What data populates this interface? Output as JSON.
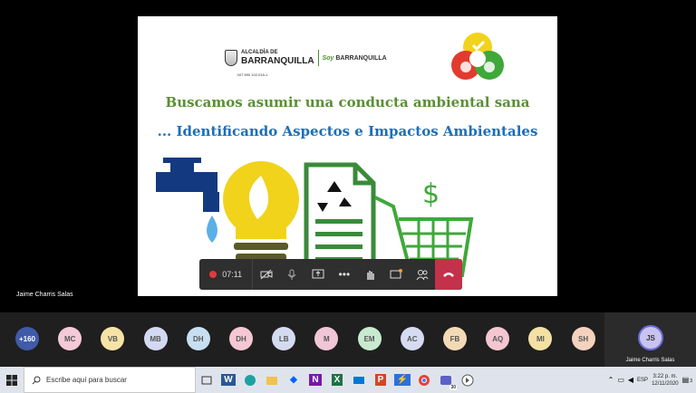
{
  "slide": {
    "org_prefix": "ALCALDÍA DE",
    "org_name": "BARRANQUILLA",
    "soy": "Soy",
    "soy_city": "BARRANQUILLA",
    "nit": "NIT 890 102.018-1",
    "title_line1": "Buscamos asumir una conducta ambiental sana",
    "title_line2": "... Identificando Aspectos e Impactos Ambientales",
    "colors": {
      "green": "#5a8f32",
      "blue": "#1d6fb8",
      "navy": "#133a80",
      "yellow": "#f1d31c"
    }
  },
  "call_controls": {
    "timer": "07:11",
    "buttons": [
      "camera-off",
      "mic",
      "share-screen",
      "more",
      "raise-hand",
      "chat",
      "participants",
      "hang-up"
    ]
  },
  "presenter_name": "Jaime Charris Salas",
  "participants": [
    {
      "initials": "+160",
      "color": "#3f5ba9",
      "text_color": "#ffffff"
    },
    {
      "initials": "MC",
      "color": "#f4c9d8"
    },
    {
      "initials": "VB",
      "color": "#f7e3a6"
    },
    {
      "initials": "MB",
      "color": "#d3d9f2"
    },
    {
      "initials": "DH",
      "color": "#c8dff2"
    },
    {
      "initials": "DH",
      "color": "#f5c7d4"
    },
    {
      "initials": "LB",
      "color": "#d4dbf0"
    },
    {
      "initials": "M",
      "color": "#f1c6d6"
    },
    {
      "initials": "EM",
      "color": "#c8eace"
    },
    {
      "initials": "AC",
      "color": "#d6dbf2"
    },
    {
      "initials": "FB",
      "color": "#f3dab6"
    },
    {
      "initials": "AQ",
      "color": "#f3c6d2"
    },
    {
      "initials": "MI",
      "color": "#f3e1a4"
    },
    {
      "initials": "SH",
      "color": "#f4d2bd"
    }
  ],
  "self": {
    "initials": "JS",
    "name": "Jaime Charris Salas"
  },
  "taskbar": {
    "search_placeholder": "Escribe aquí para buscar",
    "apps": [
      "task-view",
      "word",
      "edge",
      "file-explorer",
      "dropbox",
      "onenote",
      "excel",
      "mail",
      "powerpoint",
      "power-automate",
      "chrome",
      "teams",
      "browser"
    ],
    "teams_badge": "30",
    "language": "ESP",
    "time": "3:22 p. m.",
    "date": "12/11/2020",
    "notification_count": "3"
  }
}
